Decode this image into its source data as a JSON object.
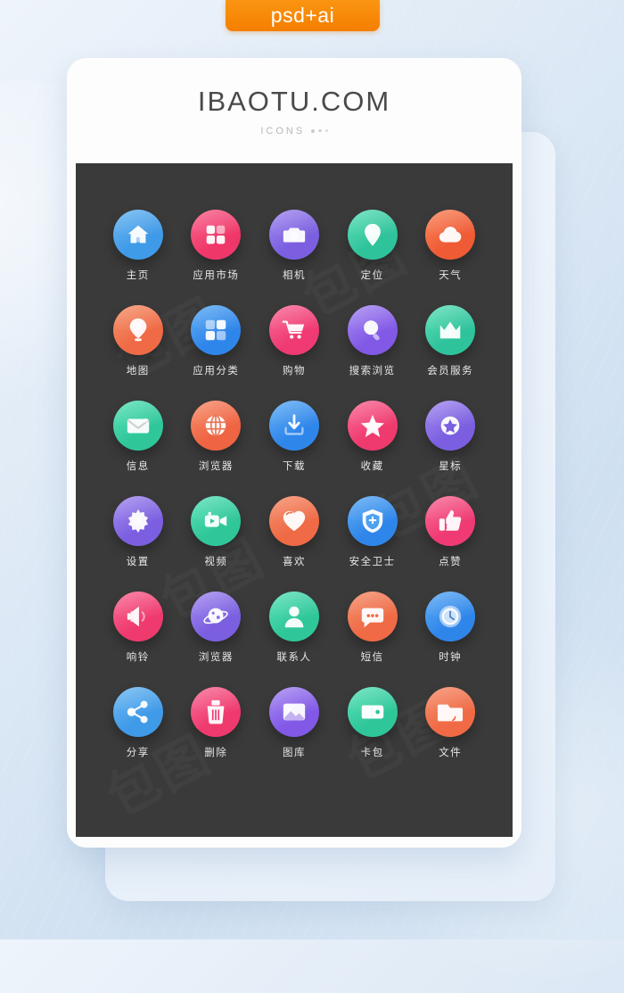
{
  "badge": {
    "label": "psd+ai",
    "color": "#f57e00"
  },
  "card": {
    "brand": "IBAOTU.COM",
    "subtitle": "ICONS",
    "panel_color": "#3a3a3a",
    "watermark": "包图"
  },
  "icons": [
    {
      "label": "主页",
      "icon": "home-icon",
      "color": "#3f9ae8",
      "color2": "#6fb8f2"
    },
    {
      "label": "应用市场",
      "icon": "app-store-icon",
      "color": "#f0376a",
      "color2": "#f9698f"
    },
    {
      "label": "相机",
      "icon": "camera-icon",
      "color": "#7b5fe0",
      "color2": "#a48df0"
    },
    {
      "label": "定位",
      "icon": "location-pin-icon",
      "color": "#2fc39b",
      "color2": "#62e0bb"
    },
    {
      "label": "天气",
      "icon": "cloud-icon",
      "color": "#ef5b35",
      "color2": "#f98a60"
    },
    {
      "label": "地图",
      "icon": "map-pin-icon",
      "color": "#ef6a45",
      "color2": "#f59671"
    },
    {
      "label": "应用分类",
      "icon": "grid-icon",
      "color": "#2f86ea",
      "color2": "#62aef5"
    },
    {
      "label": "购物",
      "icon": "cart-icon",
      "color": "#ef3a73",
      "color2": "#f97099"
    },
    {
      "label": "搜索浏览",
      "icon": "search-icon",
      "color": "#8159e6",
      "color2": "#a98df2"
    },
    {
      "label": "会员服务",
      "icon": "crown-icon",
      "color": "#2fc39b",
      "color2": "#62e0bb"
    },
    {
      "label": "信息",
      "icon": "envelope-icon",
      "color": "#2fc79a",
      "color2": "#5fe2ba"
    },
    {
      "label": "浏览器",
      "icon": "globe-icon",
      "color": "#ef6442",
      "color2": "#f7916f"
    },
    {
      "label": "下载",
      "icon": "download-icon",
      "color": "#2f86ea",
      "color2": "#66b1f6"
    },
    {
      "label": "收藏",
      "icon": "star-icon",
      "color": "#ef3a6e",
      "color2": "#f97098"
    },
    {
      "label": "星标",
      "icon": "star-circle-icon",
      "color": "#7b5fe0",
      "color2": "#a68ef0"
    },
    {
      "label": "设置",
      "icon": "gear-icon",
      "color": "#7b5fe0",
      "color2": "#a68ef0"
    },
    {
      "label": "视频",
      "icon": "video-camera-icon",
      "color": "#2fc79a",
      "color2": "#5fe2ba"
    },
    {
      "label": "喜欢",
      "icon": "heart-icon",
      "color": "#ef6a45",
      "color2": "#f5916f"
    },
    {
      "label": "安全卫士",
      "icon": "shield-icon",
      "color": "#2f86ea",
      "color2": "#62aef5"
    },
    {
      "label": "点赞",
      "icon": "thumbs-up-icon",
      "color": "#ef3a73",
      "color2": "#f97099"
    },
    {
      "label": "响铃",
      "icon": "speaker-icon",
      "color": "#ef3a6e",
      "color2": "#f97098"
    },
    {
      "label": "浏览器",
      "icon": "planet-icon",
      "color": "#7b5fe0",
      "color2": "#a68ef0"
    },
    {
      "label": "联系人",
      "icon": "person-icon",
      "color": "#2fc79a",
      "color2": "#5fe2ba"
    },
    {
      "label": "短信",
      "icon": "chat-bubble-icon",
      "color": "#ef6a45",
      "color2": "#f5916f"
    },
    {
      "label": "时钟",
      "icon": "clock-icon",
      "color": "#2f86ea",
      "color2": "#62aef5"
    },
    {
      "label": "分享",
      "icon": "share-icon",
      "color": "#3f9ae8",
      "color2": "#72bcf4"
    },
    {
      "label": "删除",
      "icon": "trash-icon",
      "color": "#ef3a6e",
      "color2": "#f97098"
    },
    {
      "label": "图库",
      "icon": "image-icon",
      "color": "#8159e6",
      "color2": "#a98df2"
    },
    {
      "label": "卡包",
      "icon": "wallet-icon",
      "color": "#2fc79a",
      "color2": "#5fe2ba"
    },
    {
      "label": "文件",
      "icon": "folder-icon",
      "color": "#ef6a45",
      "color2": "#f5916f"
    }
  ]
}
